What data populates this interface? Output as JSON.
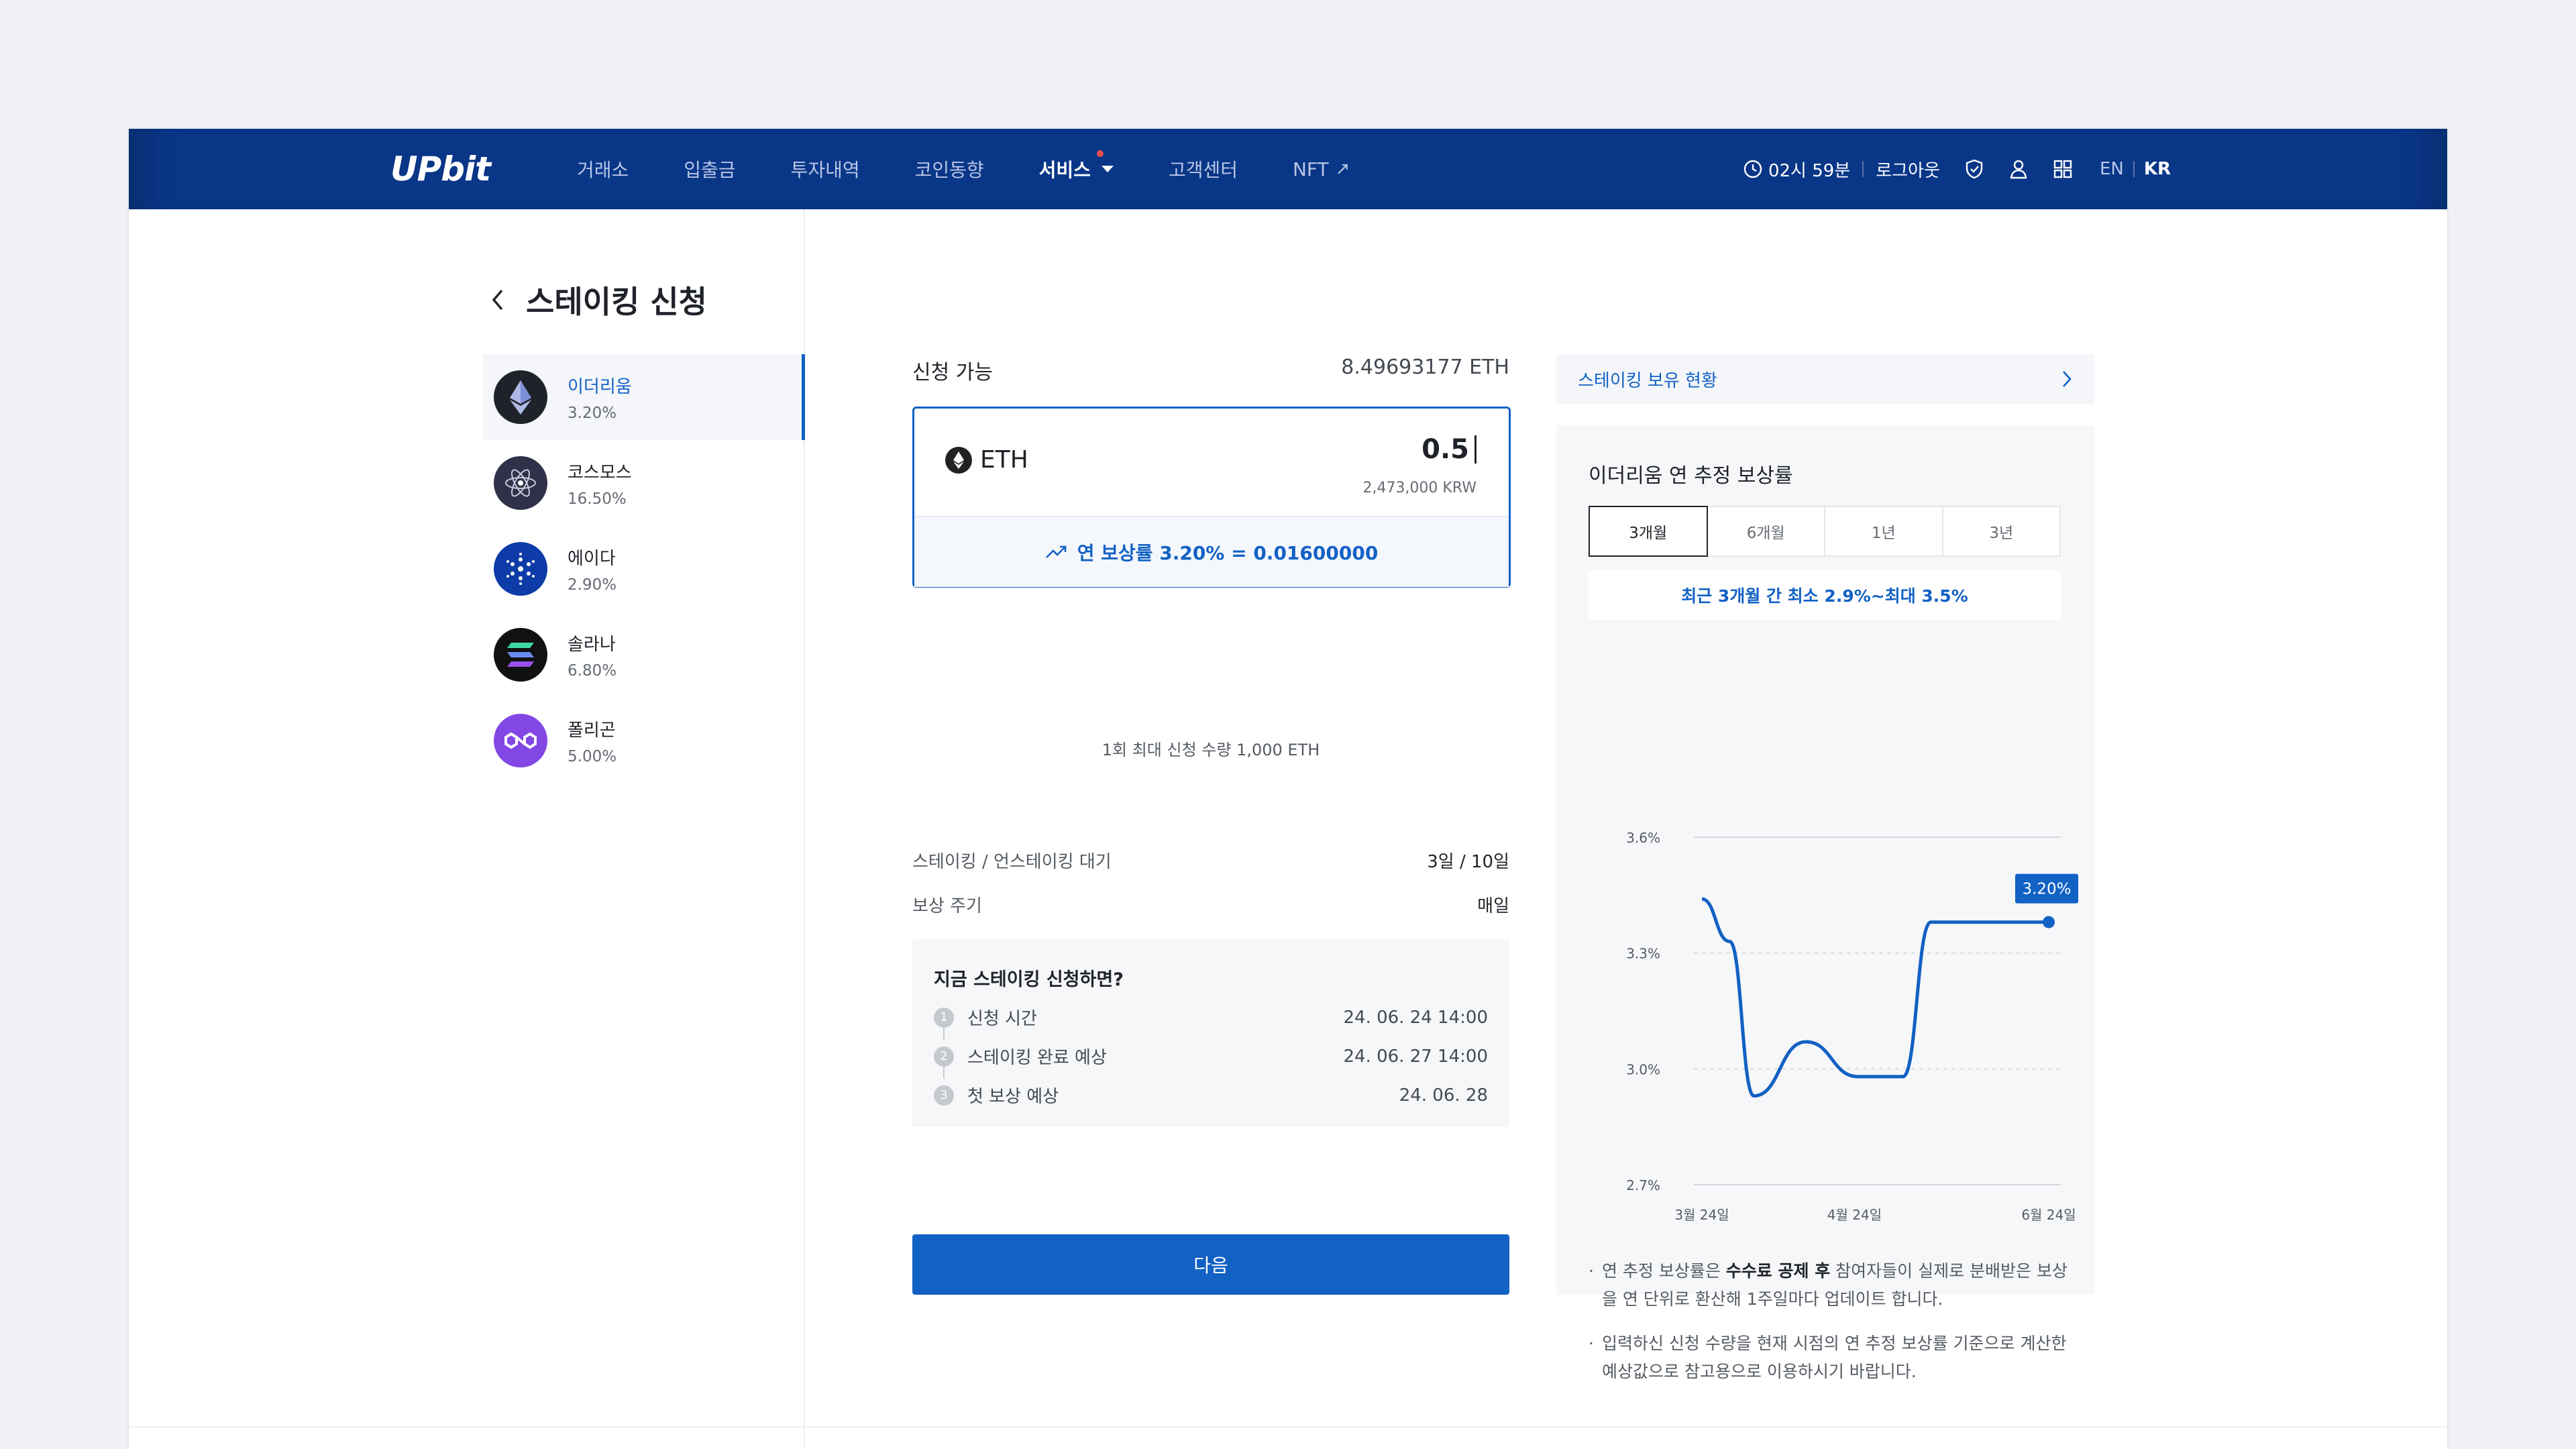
{
  "header": {
    "logo": "UPbit",
    "nav": [
      {
        "label": "거래소"
      },
      {
        "label": "입출금"
      },
      {
        "label": "투자내역"
      },
      {
        "label": "코인동향"
      },
      {
        "label": "서비스"
      },
      {
        "label": "고객센터"
      },
      {
        "label": "NFT"
      }
    ],
    "timer": "02시 59분",
    "logout": "로그아웃",
    "lang_en": "EN",
    "lang_kr": "KR"
  },
  "page": {
    "title": "스테이킹 신청"
  },
  "coins": [
    {
      "name": "이더리움",
      "rate": "3.20%"
    },
    {
      "name": "코스모스",
      "rate": "16.50%"
    },
    {
      "name": "에이다",
      "rate": "2.90%"
    },
    {
      "name": "솔라나",
      "rate": "6.80%"
    },
    {
      "name": "폴리곤",
      "rate": "5.00%"
    }
  ],
  "form": {
    "available_label": "신청 가능",
    "available_value": "8.49693177 ETH",
    "asset": "ETH",
    "amount": "0.5",
    "krw": "2,473,000 KRW",
    "reward_summary": "연 보상률 3.20% = 0.01600000",
    "max_note": "1회 최대 신청 수량 1,000 ETH",
    "wait_label": "스테이킹 / 언스테이킹 대기",
    "wait_value": "3일 / 10일",
    "cycle_label": "보상 주기",
    "cycle_value": "매일",
    "timeline_title": "지금 스테이킹 신청하면?",
    "steps": [
      {
        "num": "1",
        "label": "신청 시간",
        "value": "24. 06. 24 14:00"
      },
      {
        "num": "2",
        "label": "스테이킹 완료 예상",
        "value": "24. 06. 27 14:00"
      },
      {
        "num": "3",
        "label": "첫 보상 예상",
        "value": "24. 06. 28"
      }
    ],
    "next_button": "다음"
  },
  "right": {
    "holdings_link": "스테이킹 보유 현황",
    "card_title": "이더리움 연 추정 보상률",
    "tabs": [
      "3개월",
      "6개월",
      "1년",
      "3년"
    ],
    "active_tab": "3개월",
    "range_note": "최근 3개월 간 최소 2.9%~최대 3.5%",
    "notes": [
      {
        "pre": "연 추정 보상률은 ",
        "bold": "수수료 공제 후",
        "post": " 참여자들이 실제로 분배받은 보상을 연 단위로 환산해 1주일마다 업데이트 합니다."
      },
      {
        "pre": "입력하신 신청 수량을 현재 시점의 연 추정 보상률 기준으로 계산한 예상값으로 참고용으로 이용하시기 바랍니다.",
        "bold": "",
        "post": ""
      }
    ]
  },
  "chart_data": {
    "type": "line",
    "y_ticks": [
      "3.6%",
      "3.3%",
      "3.0%",
      "2.7%"
    ],
    "x_ticks": [
      "3월 24일",
      "4월 24일",
      "6월 24일"
    ],
    "ylim": [
      2.7,
      3.6
    ],
    "series": [
      {
        "values": [
          [
            0.0,
            3.44
          ],
          [
            0.08,
            3.33
          ],
          [
            0.15,
            2.93
          ],
          [
            0.3,
            3.07
          ],
          [
            0.45,
            2.98
          ],
          [
            0.58,
            2.98
          ],
          [
            0.66,
            3.38
          ],
          [
            1.0,
            3.38
          ]
        ]
      }
    ],
    "last_label": "3.20%",
    "color": "#1261c4"
  }
}
